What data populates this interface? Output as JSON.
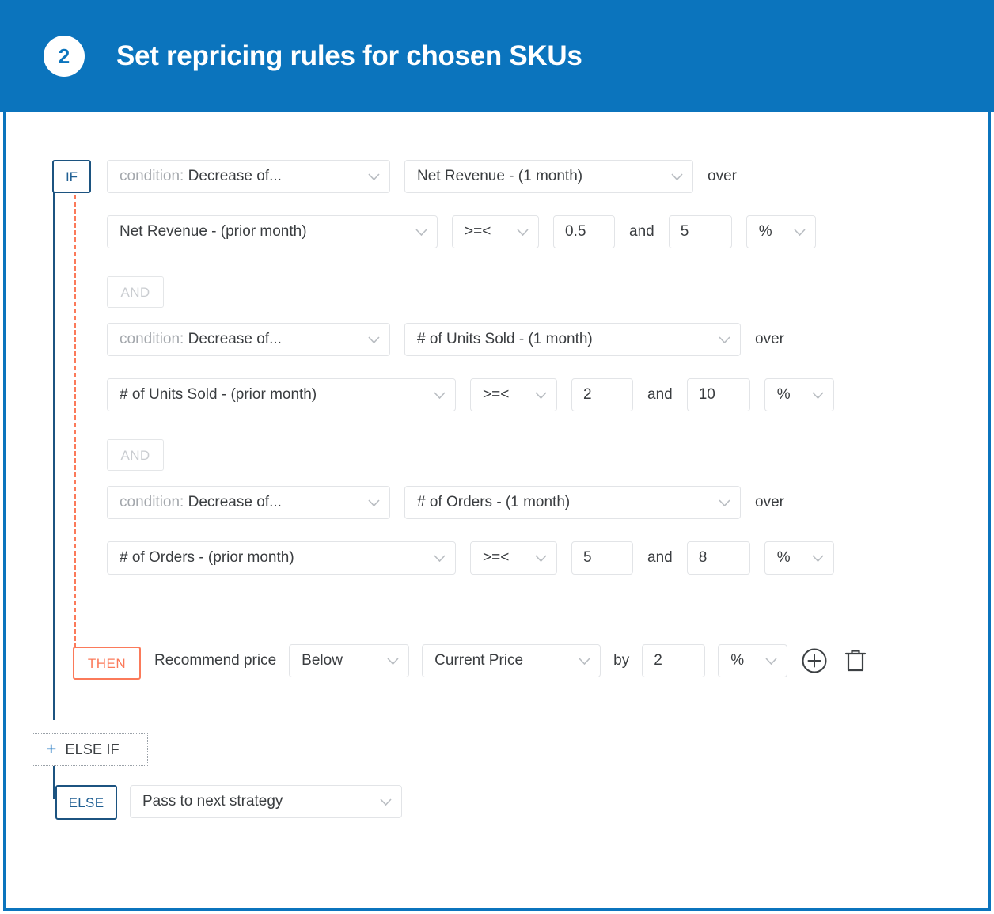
{
  "header": {
    "step_number": "2",
    "title": "Set repricing rules for chosen SKUs",
    "accent_color": "#0b74bd"
  },
  "colors": {
    "accent": "#0b74bd",
    "if_badge": "#1c5380",
    "then_badge": "#fb7a5a",
    "dashed_connector": "#fb7a5a",
    "link": "#2b7dc4"
  },
  "rule_builder": {
    "if_badge_label": "IF",
    "and_badge_label": "AND",
    "then_badge_label": "THEN",
    "else_badge_label": "ELSE",
    "else_if_label": "ELSE IF",
    "else_if_plus": "+",
    "over_label": "over",
    "and_label": "and",
    "by_label": "by",
    "conditions": [
      {
        "condition_select": {
          "prefix": "condition:",
          "value": "Decrease of..."
        },
        "metric_current": "Net Revenue - (1 month)",
        "over_label": "over",
        "metric_prior": "Net Revenue - (prior month)",
        "operator": ">=<",
        "value_min": "0.5",
        "and_label": "and",
        "value_max": "5",
        "unit": "%"
      },
      {
        "condition_select": {
          "prefix": "condition:",
          "value": "Decrease of..."
        },
        "metric_current": "# of Units Sold - (1 month)",
        "over_label": "over",
        "metric_prior": "# of Units Sold - (prior month)",
        "operator": ">=<",
        "value_min": "2",
        "and_label": "and",
        "value_max": "10",
        "unit": "%"
      },
      {
        "condition_select": {
          "prefix": "condition:",
          "value": "Decrease of..."
        },
        "metric_current": "# of Orders - (1 month)",
        "over_label": "over",
        "metric_prior": "# of Orders - (prior month)",
        "operator": ">=<",
        "value_min": "5",
        "and_label": "and",
        "value_max": "8",
        "unit": "%"
      }
    ],
    "then_action": {
      "label": "Recommend price",
      "direction": "Below",
      "reference": "Current Price",
      "by_label": "by",
      "amount": "2",
      "unit": "%",
      "add_icon": "plus-circle-icon",
      "delete_icon": "trash-icon"
    },
    "else_action": {
      "value": "Pass to next strategy"
    }
  }
}
